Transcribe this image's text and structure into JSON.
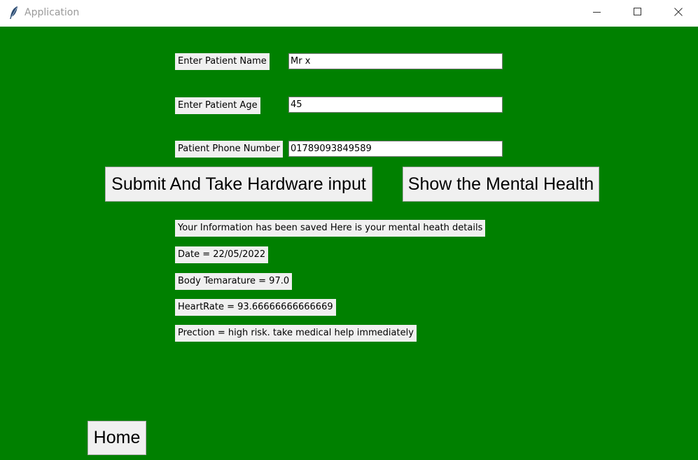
{
  "window": {
    "title": "Application",
    "icon": "feather-icon",
    "controls": [
      "minimize-icon",
      "maximize-icon",
      "close-icon"
    ]
  },
  "colors": {
    "background": "#008000",
    "label_bg": "#f0f0f0",
    "button_bg": "#f0f0f0"
  },
  "form": {
    "name_label": "Enter Patient Name",
    "name_value": "Mr x",
    "age_label": "Enter Patient Age",
    "age_value": "45",
    "phone_label": "Patient Phone Number",
    "phone_value": "01789093849589"
  },
  "buttons": {
    "submit": "Submit And Take Hardware input",
    "show": "Show the Mental Health",
    "home": "Home"
  },
  "results": {
    "saved_message": "Your Information has been saved Here is your mental heath details",
    "date": "Date = 22/05/2022",
    "temperature": "Body Temarature = 97.0",
    "heart_rate": "HeartRate = 93.66666666666669",
    "prediction": "Prection = high risk. take medical help immediately"
  }
}
